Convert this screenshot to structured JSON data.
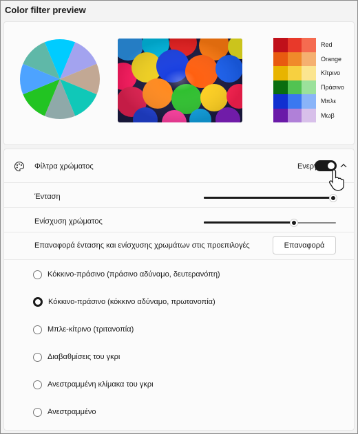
{
  "window": {
    "title": "Color filter preview"
  },
  "preview": {
    "pie_colors": [
      "#00ccff",
      "#a3a3ef",
      "#c2a894",
      "#10c8b8",
      "#8fa9a9",
      "#22c422",
      "#4da3ff",
      "#5fb8a8"
    ],
    "swatch_rows": [
      {
        "label": "Red",
        "colors": [
          "#c0101a",
          "#e8392a",
          "#f56b50"
        ]
      },
      {
        "label": "Orange",
        "colors": [
          "#e85a10",
          "#f08a2a",
          "#f5b070"
        ]
      },
      {
        "label": "Κίτρινο",
        "colors": [
          "#e8b400",
          "#f7d040",
          "#fbe590"
        ]
      },
      {
        "label": "Πράσινο",
        "colors": [
          "#0a6e10",
          "#52c352",
          "#9be19b"
        ]
      },
      {
        "label": "Μπλε",
        "colors": [
          "#1030d0",
          "#3a78f0",
          "#8ab4f8"
        ]
      },
      {
        "label": "Μωβ",
        "colors": [
          "#6a1aa8",
          "#b080d8",
          "#d8c0ea"
        ]
      }
    ]
  },
  "settings": {
    "color_filters": {
      "label": "Φίλτρα χρώματος",
      "state_label": "Ενεργ",
      "enabled": true,
      "icon": "palette-icon",
      "expand_icon": "chevron-up-icon"
    },
    "intensity": {
      "label": "Ένταση",
      "value": 1.0
    },
    "color_boost": {
      "label": "Ενίσχυση χρώματος",
      "value": 0.68
    },
    "reset": {
      "label": "Επαναφορά έντασης και ενίσχυσης χρωμάτων στις προεπιλογές",
      "button": "Επαναφορά"
    },
    "filters": [
      {
        "label": "Κόκκινο-πράσινο (πράσινο αδύναμο, δευτερανόπη)",
        "checked": false
      },
      {
        "label": "Κόκκινο-πράσινο (κόκκινο αδύναμο, πρωτανοπία)",
        "checked": true
      },
      {
        "label": "Μπλε-κίτρινο (τριτανοπία)",
        "checked": false
      },
      {
        "label": "Διαβαθμίσεις του γκρι",
        "checked": false
      },
      {
        "label": "Ανεστραμμένη κλίμακα του γκρι",
        "checked": false
      },
      {
        "label": "Ανεστραμμένο",
        "checked": false
      }
    ]
  }
}
